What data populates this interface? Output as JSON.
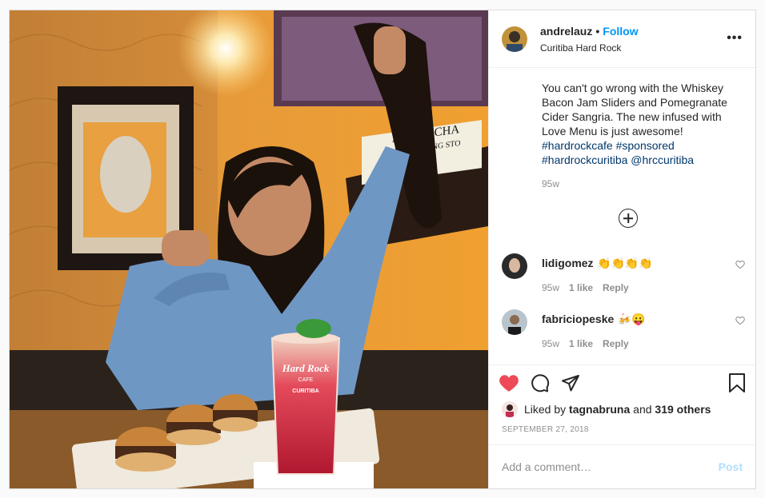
{
  "post": {
    "header": {
      "username": "andrelauz",
      "separator": "•",
      "follow_label": "Follow",
      "location": "Curitiba Hard Rock",
      "more_label": "•••"
    },
    "caption": {
      "text": "You can't go wrong with the Whiskey Bacon Jam Sliders and Pomegranate Cider Sangria. The new infused with Love Menu is just awesome!",
      "hashtags": "#hardrockcafe #sponsored #hardrockcuritiba",
      "mention": "@hrccuritiba",
      "time": "95w"
    },
    "comments": [
      {
        "username": "lidigomez",
        "text": "👏👏👏👏",
        "time": "95w",
        "likes": "1 like",
        "reply": "Reply"
      },
      {
        "username": "fabriciopeske",
        "text": "🍻😛",
        "time": "95w",
        "likes": "1 like",
        "reply": "Reply"
      }
    ],
    "likes": {
      "prefix": "Liked by",
      "user": "tagnabruna",
      "middle": "and",
      "others": "319 others"
    },
    "date": "SEPTEMBER 27, 2018",
    "add_comment": {
      "placeholder": "Add a comment…",
      "post_label": "Post"
    },
    "photo": {
      "poster_text": "EITH RICHA",
      "poster_sub": "THE ROLLING STO",
      "glass_brand": "Hard Rock",
      "glass_sub": "CAFE",
      "glass_city": "CURITIBA"
    }
  },
  "colors": {
    "accent": "#0095f6",
    "like": "#ed4956",
    "hashtag": "#00376b",
    "muted": "#8e8e8e"
  },
  "icons": [
    "more-icon",
    "add-comments-icon",
    "heart-icon",
    "comment-icon",
    "share-icon",
    "save-icon"
  ]
}
